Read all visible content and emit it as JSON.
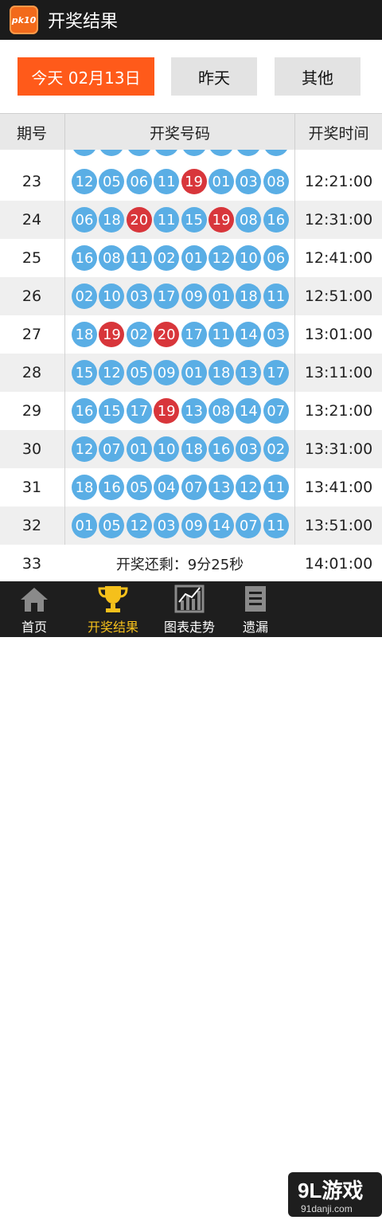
{
  "header": {
    "title": "开奖结果",
    "icon_label": "pk10"
  },
  "filters": {
    "today": "今天  02月13日",
    "yesterday": "昨天",
    "other": "其他"
  },
  "columns": {
    "issue": "期号",
    "numbers": "开奖号码",
    "time": "开奖时间"
  },
  "colors": {
    "accent": "#ff5a1a",
    "ball_blue": "#5aaee5",
    "ball_red": "#d8363b",
    "tab_active": "#f5c01b"
  },
  "rows": [
    {
      "issue": "23",
      "time": "12:21:00",
      "balls": [
        [
          "12",
          "b"
        ],
        [
          "05",
          "b"
        ],
        [
          "06",
          "b"
        ],
        [
          "11",
          "b"
        ],
        [
          "19",
          "r"
        ],
        [
          "01",
          "b"
        ],
        [
          "03",
          "b"
        ],
        [
          "08",
          "b"
        ]
      ]
    },
    {
      "issue": "24",
      "time": "12:31:00",
      "balls": [
        [
          "06",
          "b"
        ],
        [
          "18",
          "b"
        ],
        [
          "20",
          "r"
        ],
        [
          "11",
          "b"
        ],
        [
          "15",
          "b"
        ],
        [
          "19",
          "r"
        ],
        [
          "08",
          "b"
        ],
        [
          "16",
          "b"
        ]
      ]
    },
    {
      "issue": "25",
      "time": "12:41:00",
      "balls": [
        [
          "16",
          "b"
        ],
        [
          "08",
          "b"
        ],
        [
          "11",
          "b"
        ],
        [
          "02",
          "b"
        ],
        [
          "01",
          "b"
        ],
        [
          "12",
          "b"
        ],
        [
          "10",
          "b"
        ],
        [
          "06",
          "b"
        ]
      ]
    },
    {
      "issue": "26",
      "time": "12:51:00",
      "balls": [
        [
          "02",
          "b"
        ],
        [
          "10",
          "b"
        ],
        [
          "03",
          "b"
        ],
        [
          "17",
          "b"
        ],
        [
          "09",
          "b"
        ],
        [
          "01",
          "b"
        ],
        [
          "18",
          "b"
        ],
        [
          "11",
          "b"
        ]
      ]
    },
    {
      "issue": "27",
      "time": "13:01:00",
      "balls": [
        [
          "18",
          "b"
        ],
        [
          "19",
          "r"
        ],
        [
          "02",
          "b"
        ],
        [
          "20",
          "r"
        ],
        [
          "17",
          "b"
        ],
        [
          "11",
          "b"
        ],
        [
          "14",
          "b"
        ],
        [
          "03",
          "b"
        ]
      ]
    },
    {
      "issue": "28",
      "time": "13:11:00",
      "balls": [
        [
          "15",
          "b"
        ],
        [
          "12",
          "b"
        ],
        [
          "05",
          "b"
        ],
        [
          "09",
          "b"
        ],
        [
          "01",
          "b"
        ],
        [
          "18",
          "b"
        ],
        [
          "13",
          "b"
        ],
        [
          "17",
          "b"
        ]
      ]
    },
    {
      "issue": "29",
      "time": "13:21:00",
      "balls": [
        [
          "16",
          "b"
        ],
        [
          "15",
          "b"
        ],
        [
          "17",
          "b"
        ],
        [
          "19",
          "r"
        ],
        [
          "13",
          "b"
        ],
        [
          "08",
          "b"
        ],
        [
          "14",
          "b"
        ],
        [
          "07",
          "b"
        ]
      ]
    },
    {
      "issue": "30",
      "time": "13:31:00",
      "balls": [
        [
          "12",
          "b"
        ],
        [
          "07",
          "b"
        ],
        [
          "01",
          "b"
        ],
        [
          "10",
          "b"
        ],
        [
          "18",
          "b"
        ],
        [
          "16",
          "b"
        ],
        [
          "03",
          "b"
        ],
        [
          "02",
          "b"
        ]
      ]
    },
    {
      "issue": "31",
      "time": "13:41:00",
      "balls": [
        [
          "18",
          "b"
        ],
        [
          "16",
          "b"
        ],
        [
          "05",
          "b"
        ],
        [
          "04",
          "b"
        ],
        [
          "07",
          "b"
        ],
        [
          "13",
          "b"
        ],
        [
          "12",
          "b"
        ],
        [
          "11",
          "b"
        ]
      ]
    },
    {
      "issue": "32",
      "time": "13:51:00",
      "balls": [
        [
          "01",
          "b"
        ],
        [
          "05",
          "b"
        ],
        [
          "12",
          "b"
        ],
        [
          "03",
          "b"
        ],
        [
          "09",
          "b"
        ],
        [
          "14",
          "b"
        ],
        [
          "07",
          "b"
        ],
        [
          "11",
          "b"
        ]
      ]
    }
  ],
  "pending": {
    "issue": "33",
    "remaining": "开奖还剩：9分25秒",
    "time": "14:01:00"
  },
  "tabs": [
    {
      "label": "首页",
      "icon": "home-icon"
    },
    {
      "label": "开奖结果",
      "icon": "trophy-icon"
    },
    {
      "label": "图表走势",
      "icon": "chart-icon"
    },
    {
      "label": "遗漏",
      "icon": "list-icon"
    }
  ],
  "watermark": {
    "brand": "9L游戏",
    "url": "91danji.com"
  }
}
